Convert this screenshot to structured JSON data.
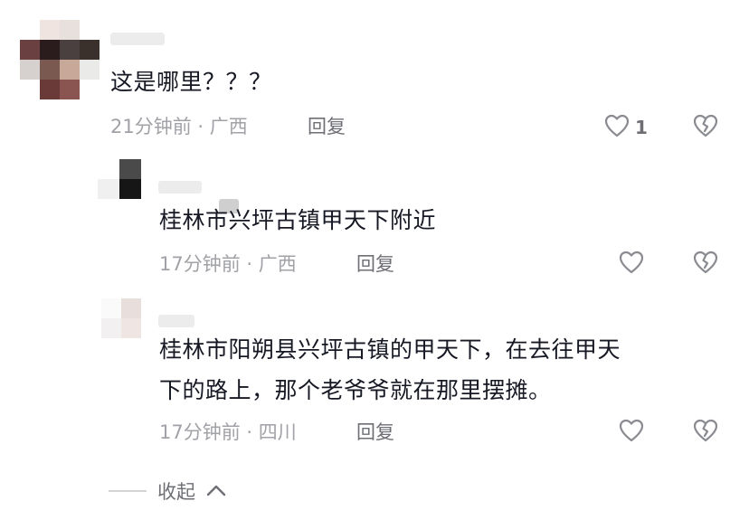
{
  "comments": [
    {
      "text": "这是哪里？？？",
      "time": "21分钟前",
      "location": "广西",
      "reply_label": "回复",
      "like_count": "1"
    }
  ],
  "replies": [
    {
      "text_lines": [
        "桂林市兴坪古镇甲天下附近"
      ],
      "time": "17分钟前",
      "location": "广西",
      "reply_label": "回复"
    },
    {
      "text_lines": [
        "桂林市阳朔县兴坪古镇的甲天下，在去往甲天",
        "下的路上，那个老爷爷就在那里摆摊。"
      ],
      "time": "17分钟前",
      "location": "四川",
      "reply_label": "回复"
    }
  ],
  "separator": "·",
  "collapse_label": "收起",
  "colors": {
    "text_primary": "#161823",
    "meta_gray": "#a1a2a7",
    "reply_gray": "#6e6f75",
    "icon_gray": "#8a8b91"
  },
  "icons": [
    "heart-outline-icon",
    "broken-heart-icon",
    "chevron-up-icon"
  ]
}
